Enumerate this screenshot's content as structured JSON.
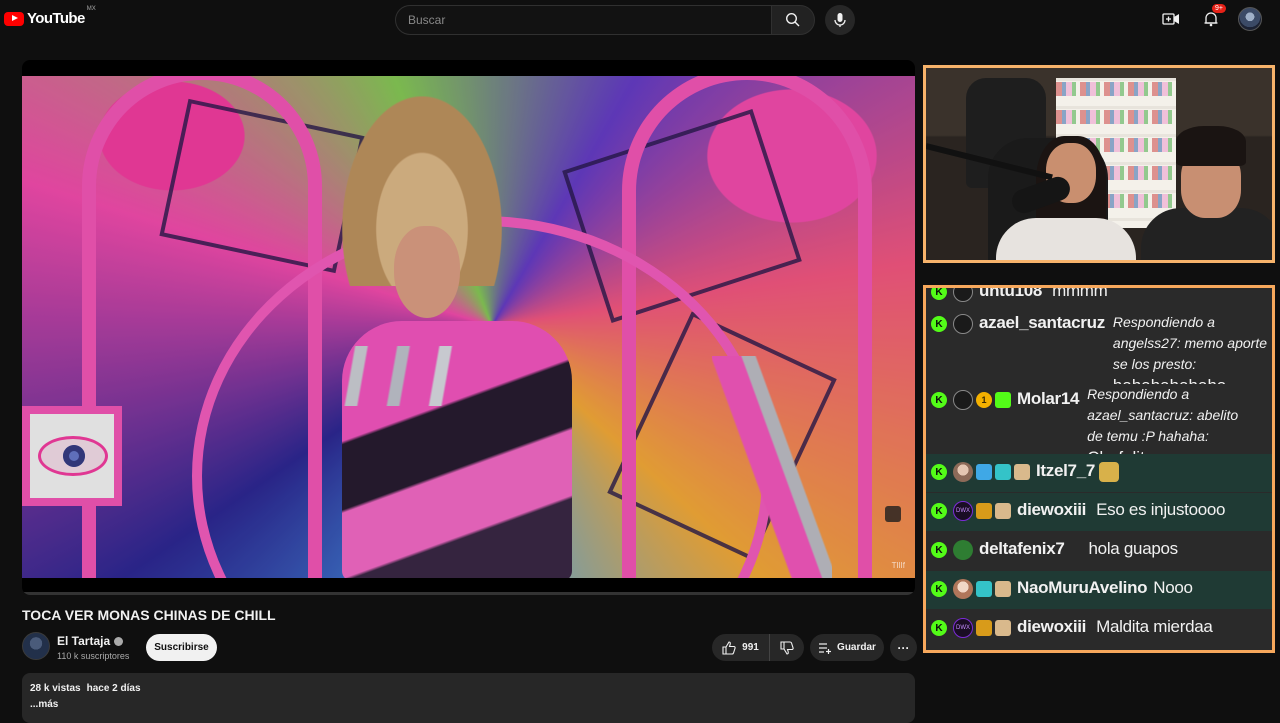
{
  "header": {
    "logo_text": "YouTube",
    "country_code": "MX",
    "search_placeholder": "Buscar",
    "notification_count": "9+"
  },
  "video": {
    "watermark": "TIlIf",
    "title": "TOCA VER MONAS CHINAS DE CHILL",
    "channel_name": "El Tartaja",
    "subscribers": "110 k suscriptores",
    "subscribe_label": "Suscribirse",
    "like_count": "991",
    "save_label": "Guardar",
    "more_label": "···"
  },
  "description": {
    "views": "28 k vistas",
    "date": "hace 2 días",
    "more": "...más"
  },
  "chat": {
    "messages": [
      {
        "username": "untu108",
        "message": "mmmm"
      },
      {
        "username": "azael_santacruz",
        "reply_to": "Respondiendo a angelss27: memo aporte se los presto:",
        "message": "hahahahahaha"
      },
      {
        "username": "Molar14",
        "badge_number": "1",
        "reply_to": "Respondiendo a azael_santacruz: abelito de temu :P hahaha:",
        "message": "Chafalito"
      },
      {
        "username": "Itzel7_7",
        "message": ""
      },
      {
        "username": "diewoxiii",
        "message": "Eso es injustoooo"
      },
      {
        "username": "deltafenix7",
        "message": "hola guapos"
      },
      {
        "username": "NaoMuruAvelino",
        "message": "Nooo"
      },
      {
        "username": "diewoxiii",
        "message": "Maldita mierdaa"
      }
    ]
  },
  "colors": {
    "kick_green": "#53fc18",
    "webcam_border": "#f7b36b",
    "chat_border": "#f7a85c",
    "highlight_row": "#1f3a34"
  }
}
